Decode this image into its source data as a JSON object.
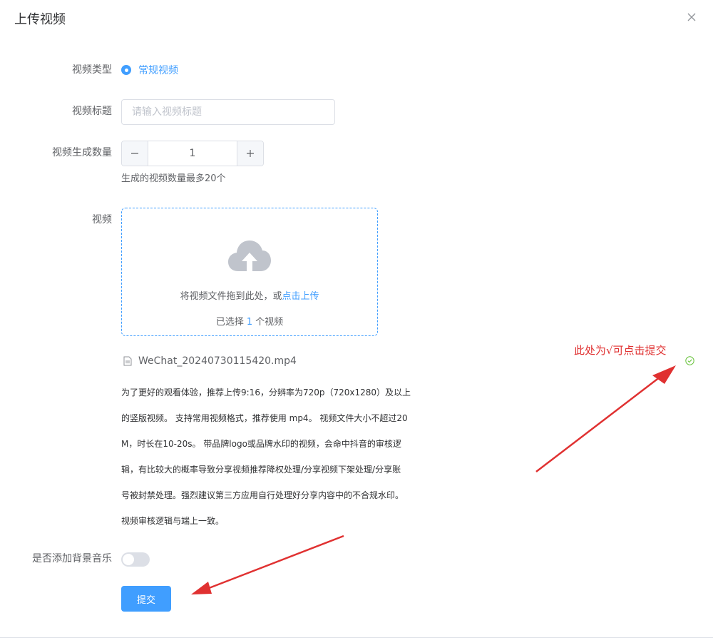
{
  "dialog": {
    "title": "上传视频"
  },
  "form": {
    "video_type": {
      "label": "视频类型",
      "option": "常规视频"
    },
    "video_title": {
      "label": "视频标题",
      "placeholder": "请输入视频标题",
      "value": ""
    },
    "generate_count": {
      "label": "视频生成数量",
      "value": "1",
      "hint": "生成的视频数量最多20个"
    },
    "video": {
      "label": "视频",
      "drop_text": "将视频文件拖到此处，或",
      "click_upload": "点击上传",
      "selected_prefix": "已选择",
      "selected_count": "1",
      "selected_suffix": "个视频",
      "file_name": "WeChat_20240730115420.mp4",
      "notes": [
        "为了更好的观看体验，推荐上传9:16，分辨率为720p（720x1280）及以上",
        "的竖版视频。 支持常用视频格式，推荐使用 mp4。 视频文件大小不超过20",
        "M，时长在10-20s。 带品牌logo或品牌水印的视频，会命中抖音的审核逻",
        "辑，有比较大的概率导致分享视频推荐降权处理/分享视频下架处理/分享账",
        "号被封禁处理。强烈建议第三方应用自行处理好分享内容中的不合规水印。",
        "视频审核逻辑与端上一致。"
      ]
    },
    "bg_music": {
      "label": "是否添加背景音乐",
      "enabled": false
    },
    "submit_label": "提交"
  },
  "annotation": {
    "text": "此处为√可点击提交",
    "color": "#e03131"
  },
  "colors": {
    "primary": "#409eff",
    "success": "#67c23a",
    "border": "#dcdfe6"
  }
}
